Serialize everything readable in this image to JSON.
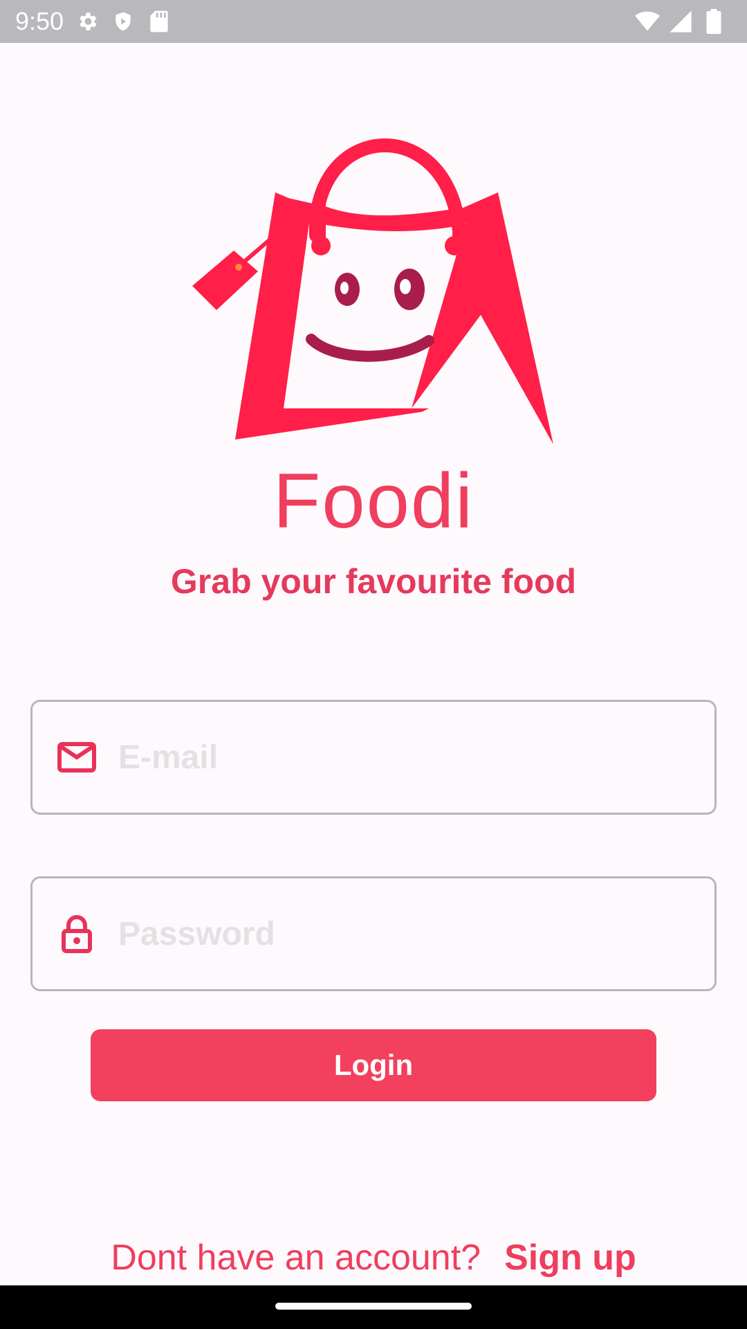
{
  "status_bar": {
    "time": "9:50",
    "icons_left": [
      "gear-icon",
      "shield-icon",
      "sd-card-icon"
    ],
    "icons_right": [
      "wifi-icon",
      "signal-icon",
      "battery-icon"
    ]
  },
  "app": {
    "title": "Foodi",
    "subtitle": "Grab your favourite food",
    "logo": "shopping-bag-smiley-logo"
  },
  "form": {
    "email": {
      "placeholder": "E-mail",
      "value": "",
      "icon": "mail-icon"
    },
    "password": {
      "placeholder": "Password",
      "value": "",
      "icon": "lock-icon"
    },
    "login_label": "Login"
  },
  "signup": {
    "prompt": "Dont have an account?",
    "link": "Sign up"
  },
  "colors": {
    "brand": "#ef3e5e",
    "button": "#f2405e",
    "background": "#fef9fc",
    "status_bar": "#b9b8bc",
    "field_border": "#b9b5b9",
    "logo_dark": "#a81d4b"
  }
}
